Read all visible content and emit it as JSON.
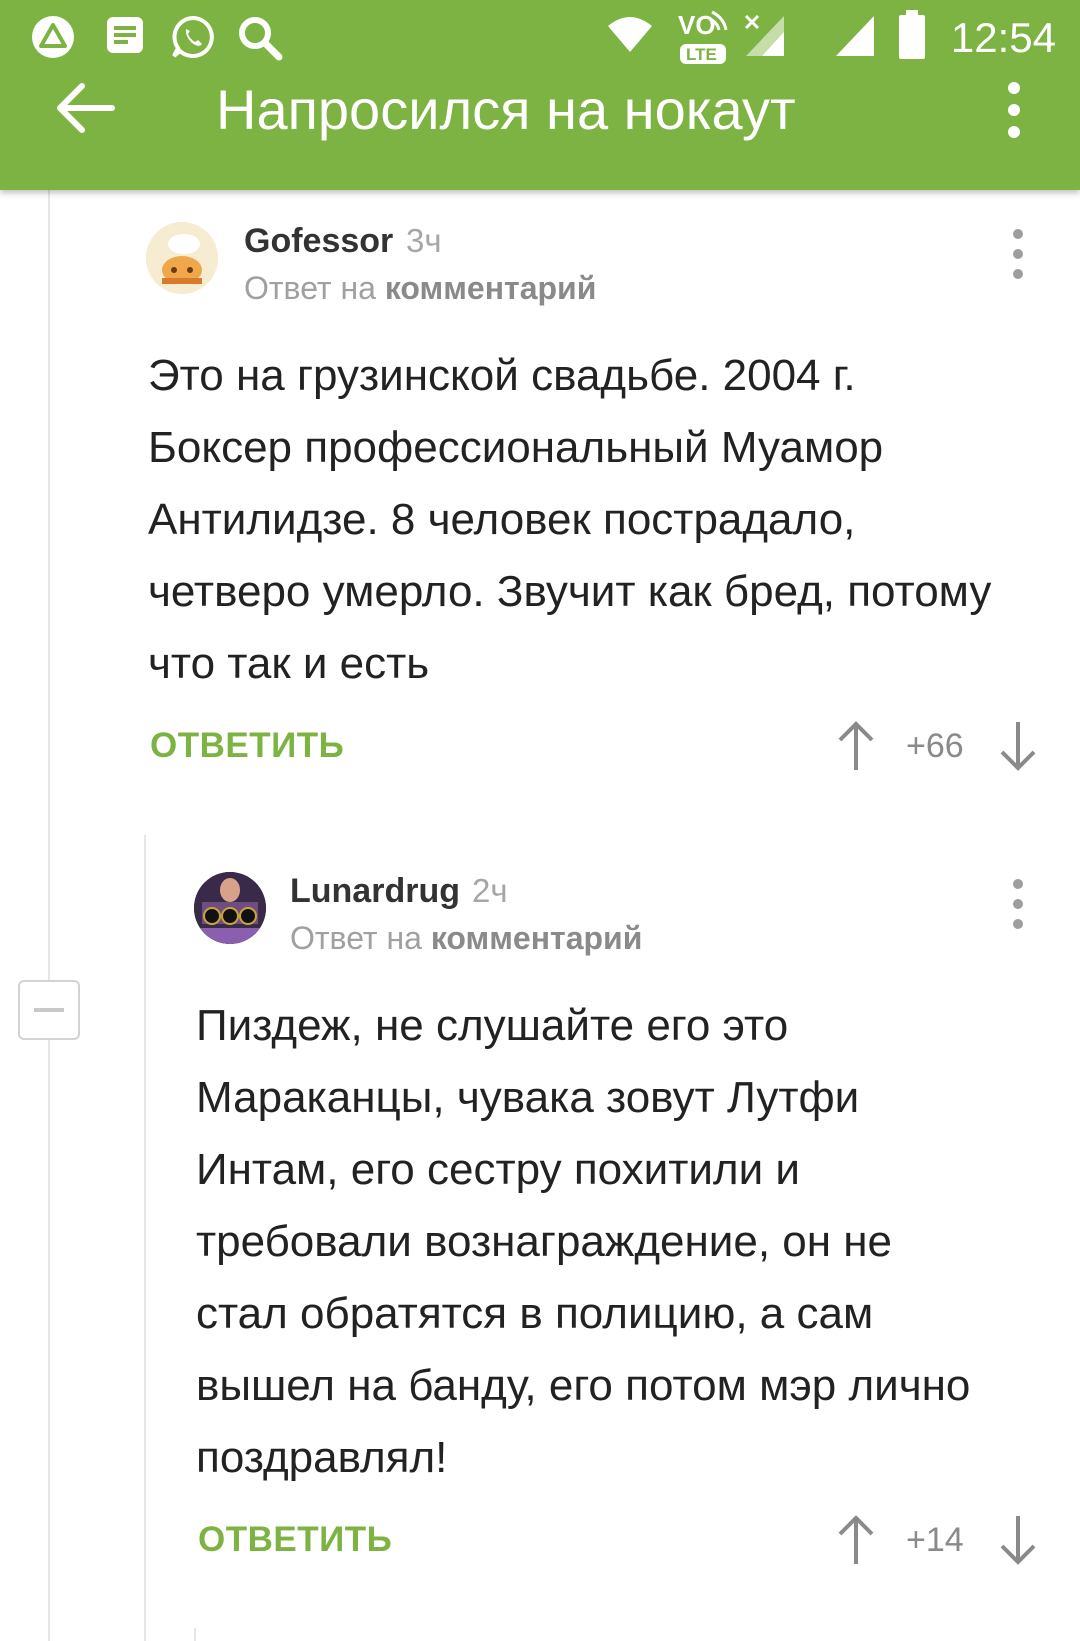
{
  "status_bar": {
    "time": "12:54",
    "lte_label": "LTE",
    "vo_label": "VO",
    "icons": [
      "alert-triangle-icon",
      "notes-icon",
      "whatsapp-icon",
      "search-icon",
      "wifi-icon",
      "volte-icon",
      "signal-icon",
      "signal-icon",
      "battery-icon"
    ]
  },
  "toolbar": {
    "title": "Напросился на нокаут",
    "back_icon": "arrow-left-icon",
    "menu_icon": "more-vert-icon"
  },
  "comments": [
    {
      "username": "Gofessor",
      "time": "3ч",
      "reply_prefix": "Ответ на",
      "reply_link": "комментарий",
      "text": "Это на грузинской свадьбе. 2004 г. Боксер профессиональный Муамор Антилидзе. 8 человек пострадало, четверо умерло. Звучит как бред, потому что так и есть",
      "reply_label": "ОТВЕТИТЬ",
      "rating": "+66"
    },
    {
      "username": "Lunardrug",
      "time": "2ч",
      "reply_prefix": "Ответ на",
      "reply_link": "комментарий",
      "text": "Пиздеж, не слушайте его это Мараканцы, чувака зовут Лутфи Интам, его сестру похитили и требовали вознаграждение, он не стал обратятся в полицию, а сам вышел на банду, его потом мэр лично поздравлял!",
      "reply_label": "ОТВЕТИТЬ",
      "rating": "+14"
    }
  ],
  "colors": {
    "accent": "#7cb342",
    "text": "#222222",
    "muted": "#a0a0a0"
  }
}
